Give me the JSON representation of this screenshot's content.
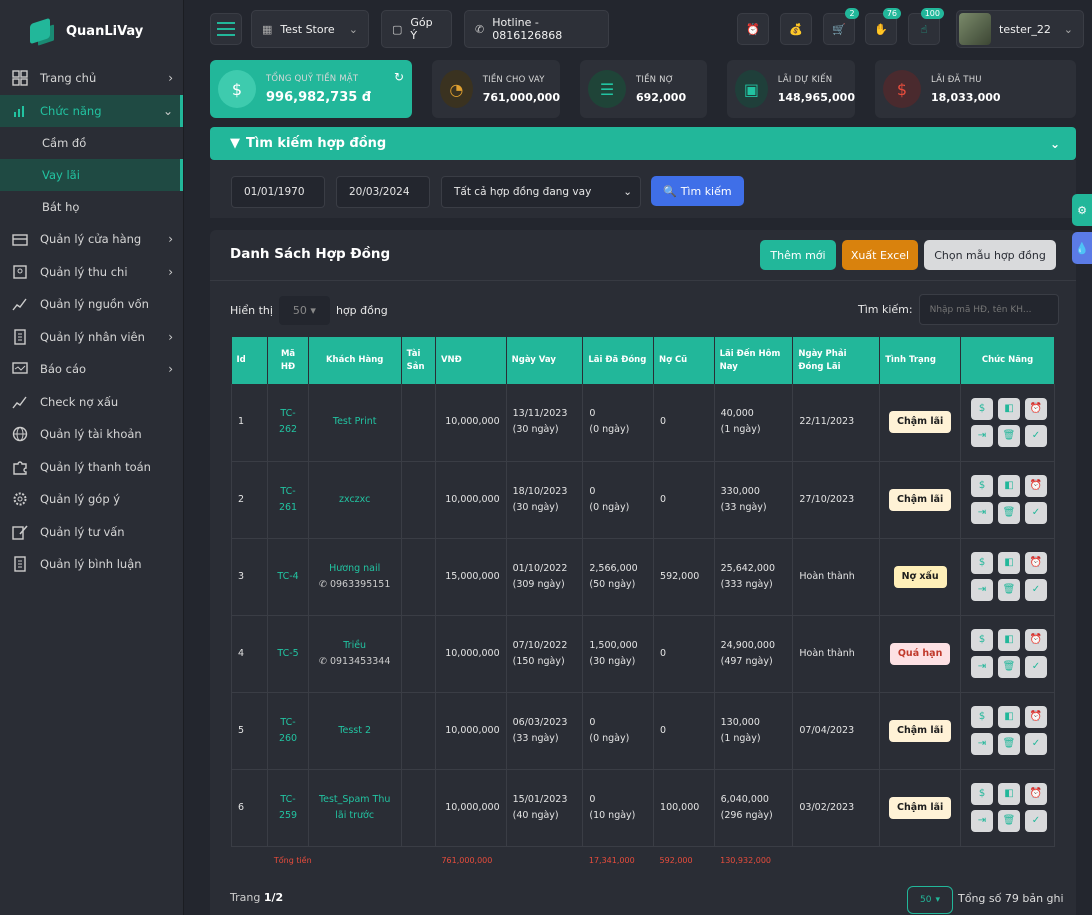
{
  "app": {
    "name": "QuanLiVay"
  },
  "sidebar": {
    "items": [
      {
        "label": "Trang chủ",
        "icon": "grid-icon",
        "chevron": "›"
      },
      {
        "label": "Chức năng",
        "icon": "bar-chart-icon",
        "chevron": "⌄"
      }
    ],
    "sub_items": [
      {
        "label": "Cầm đồ"
      },
      {
        "label": "Vay lãi"
      },
      {
        "label": "Bát họ"
      }
    ],
    "items2": [
      {
        "label": "Quản lý cửa hàng",
        "icon": "store-icon",
        "chevron": "›"
      },
      {
        "label": "Quản lý thu chi",
        "icon": "wallet-icon",
        "chevron": "›"
      },
      {
        "label": "Quản lý nguồn vốn",
        "icon": "chart-line-icon",
        "chevron": ""
      },
      {
        "label": "Quản lý nhân viên",
        "icon": "building-icon",
        "chevron": "›"
      },
      {
        "label": "Báo cáo",
        "icon": "monitor-icon",
        "chevron": "›"
      },
      {
        "label": "Check nợ xấu",
        "icon": "chart-line-icon",
        "chevron": ""
      },
      {
        "label": "Quản lý tài khoản",
        "icon": "globe-icon",
        "chevron": ""
      },
      {
        "label": "Quản lý thanh toán",
        "icon": "puzzle-icon",
        "chevron": ""
      },
      {
        "label": "Quản lý góp ý",
        "icon": "gear-icon",
        "chevron": ""
      },
      {
        "label": "Quản lý tư vấn",
        "icon": "edit-icon",
        "chevron": ""
      },
      {
        "label": "Quản lý bình luận",
        "icon": "building-icon",
        "chevron": ""
      }
    ]
  },
  "topbar": {
    "store": "Test Store",
    "feedback": "Góp Ý",
    "hotline": "Hotline - 0816126868",
    "badges": [
      "2",
      "76",
      "100"
    ],
    "user": "tester_22"
  },
  "stats": [
    {
      "label": "Tổng quỹ tiền mặt",
      "value": "996,982,735 đ"
    },
    {
      "label": "Tiền cho vay",
      "value": "761,000,000"
    },
    {
      "label": "Tiền nợ",
      "value": "692,000"
    },
    {
      "label": "Lãi dự kiến",
      "value": "148,965,000"
    },
    {
      "label": "Lãi đã thu",
      "value": "18,033,000"
    }
  ],
  "search": {
    "title": "Tìm kiếm hợp đồng",
    "from_date": "01/01/1970",
    "to_date": "20/03/2024",
    "status_select": "Tất cả hợp đồng đang vay",
    "button": "Tìm kiếm"
  },
  "list": {
    "title": "Danh Sách Hợp Đồng",
    "btn_add": "Thêm mới",
    "btn_excel": "Xuất Excel",
    "btn_template": "Chọn mẫu hợp đồng",
    "show_label": "Hiển thị",
    "page_size": "50",
    "show_suffix": "hợp đồng",
    "search_label": "Tìm kiếm:",
    "search_placeholder": "Nhập mã HĐ, tên KH..."
  },
  "table": {
    "headers": [
      "Id",
      "Mã HĐ",
      "Khách Hàng",
      "Tài Sản",
      "VNĐ",
      "Ngày Vay",
      "Lãi Đã Đóng",
      "Nợ Cũ",
      "Lãi Đến Hôm Nay",
      "Ngày Phải Đóng Lãi",
      "Tình Trạng",
      "Chức Năng"
    ],
    "rows": [
      {
        "id": "1",
        "code": "TC-262",
        "customer": "Test Print",
        "phone": "",
        "amount": "10,000,000",
        "date": "13/11/2023",
        "days": "(30 ngày)",
        "paid": "0",
        "paid_days": "(0 ngày)",
        "debt": "0",
        "interest": "40,000",
        "interest_days": "(1 ngày)",
        "due": "22/11/2023",
        "status": "Chậm lãi",
        "status_type": "cham"
      },
      {
        "id": "2",
        "code": "TC-261",
        "customer": "zxczxc",
        "phone": "",
        "amount": "10,000,000",
        "date": "18/10/2023",
        "days": "(30 ngày)",
        "paid": "0",
        "paid_days": "(0 ngày)",
        "debt": "0",
        "interest": "330,000",
        "interest_days": "(33 ngày)",
        "due": "27/10/2023",
        "status": "Chậm lãi",
        "status_type": "cham"
      },
      {
        "id": "3",
        "code": "TC-4",
        "customer": "Hương nail",
        "phone": "0963395151",
        "amount": "15,000,000",
        "date": "01/10/2022",
        "days": "(309 ngày)",
        "paid": "2,566,000",
        "paid_days": "(50 ngày)",
        "debt": "592,000",
        "interest": "25,642,000",
        "interest_days": "(333 ngày)",
        "due": "Hoàn thành",
        "status": "Nợ xấu",
        "status_type": "xau"
      },
      {
        "id": "4",
        "code": "TC-5",
        "customer": "Triều",
        "phone": "0913453344",
        "amount": "10,000,000",
        "date": "07/10/2022",
        "days": "(150 ngày)",
        "paid": "1,500,000",
        "paid_days": "(30 ngày)",
        "debt": "0",
        "interest": "24,900,000",
        "interest_days": "(497 ngày)",
        "due": "Hoàn thành",
        "status": "Quá hạn",
        "status_type": "qua"
      },
      {
        "id": "5",
        "code": "TC-260",
        "customer": "Tesst 2",
        "phone": "",
        "amount": "10,000,000",
        "date": "06/03/2023",
        "days": "(33 ngày)",
        "paid": "0",
        "paid_days": "(0 ngày)",
        "debt": "0",
        "interest": "130,000",
        "interest_days": "(1 ngày)",
        "due": "07/04/2023",
        "status": "Chậm lãi",
        "status_type": "cham"
      },
      {
        "id": "6",
        "code": "TC-259",
        "customer": "Test_Spam Thu lãi trước",
        "phone": "",
        "amount": "10,000,000",
        "date": "15/01/2023",
        "days": "(40 ngày)",
        "paid": "0",
        "paid_days": "(10 ngày)",
        "debt": "100,000",
        "interest": "6,040,000",
        "interest_days": "(296 ngày)",
        "due": "03/02/2023",
        "status": "Chậm lãi",
        "status_type": "cham"
      }
    ],
    "total_label": "Tổng tiền",
    "total_amount": "761,000,000",
    "total_paid": "17,341,000",
    "total_debt": "592,000",
    "total_interest": "130,932,000"
  },
  "footer": {
    "page_label": "Trang",
    "page_value": "1/2",
    "page_size": "50",
    "total_records": "Tổng số 79 bản ghi"
  },
  "colors": {
    "accent": "#22b79a",
    "blue": "#3f6fe8",
    "orange": "#d9820d"
  }
}
